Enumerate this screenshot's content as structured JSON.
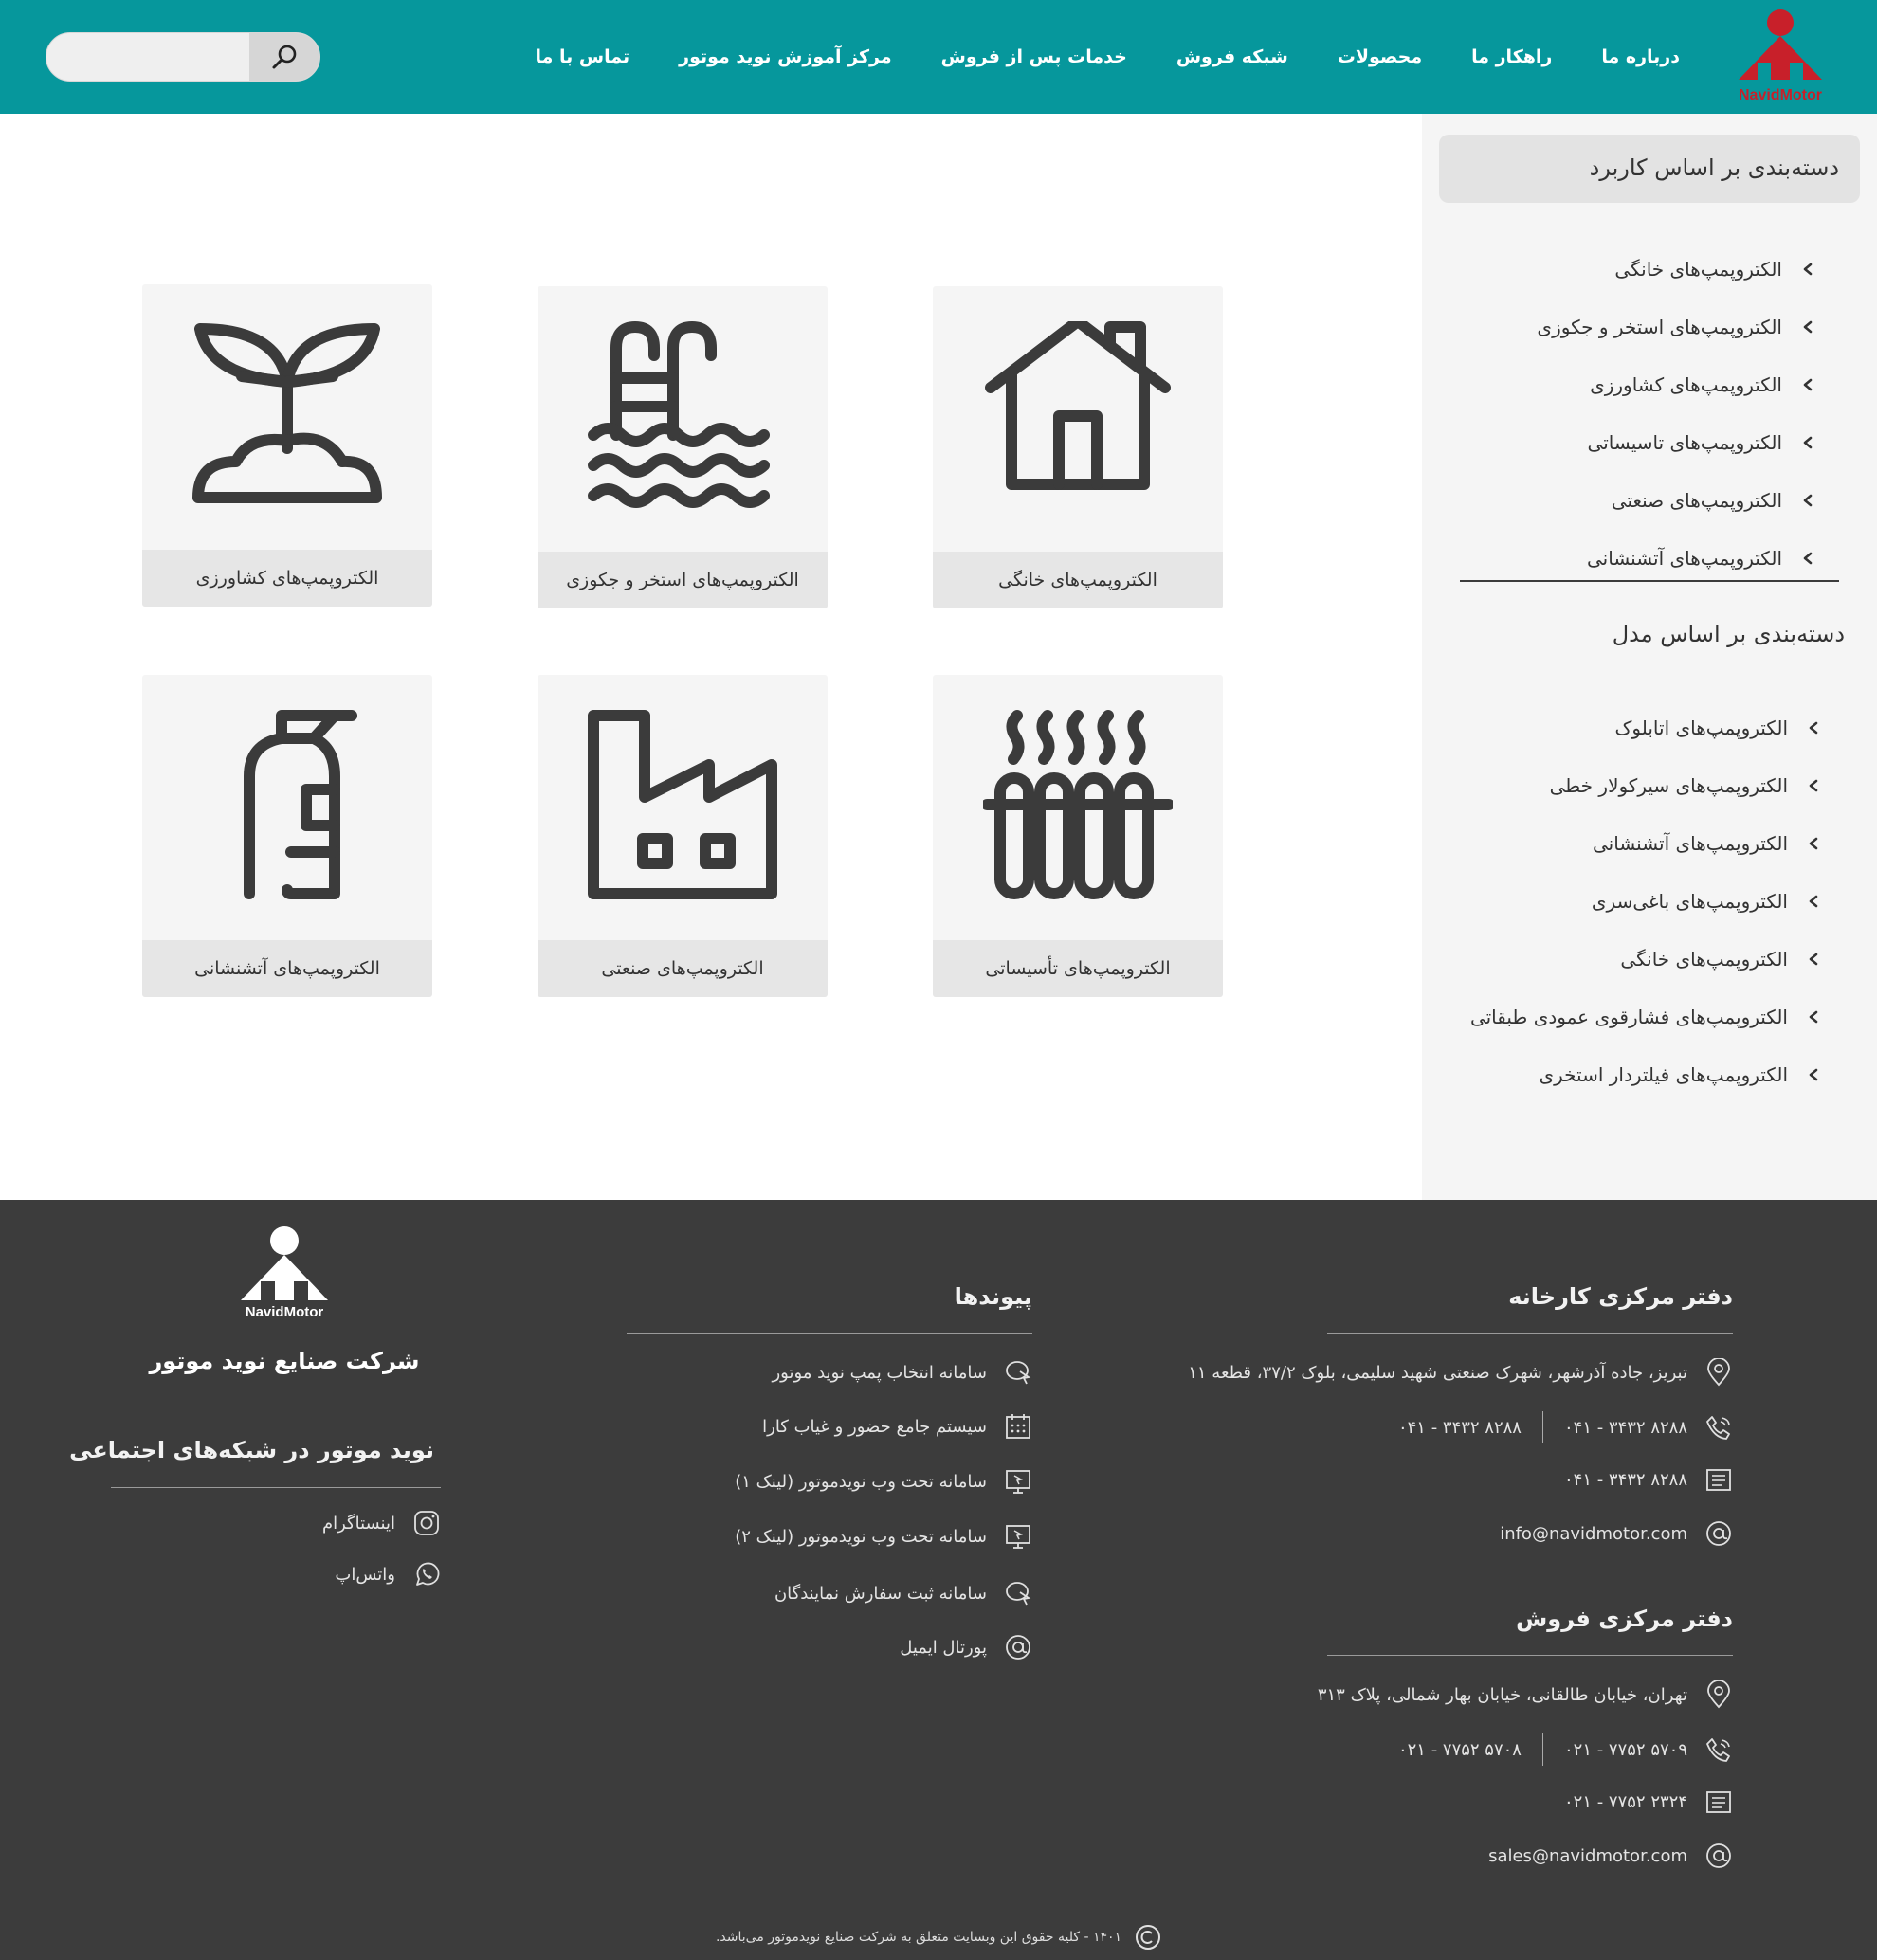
{
  "header": {
    "logo_text": "NavidMotor",
    "nav": [
      "درباره ما",
      "راهکار ما",
      "محصولات",
      "شبکه فروش",
      "خدمات پس از فروش",
      "مرکز آموزش نوید موتور",
      "تماس با ما"
    ],
    "search": {
      "placeholder": "",
      "icon": "search-icon"
    }
  },
  "sidebar": {
    "usage_title": "دسته‌بندی بر اساس کاربرد",
    "usage_items": [
      "الکتروپمپ‌های خانگی",
      "الکتروپمپ‌های استخر و جکوزی",
      "الکتروپمپ‌های کشاورزی",
      "الکتروپمپ‌های تاسیساتی",
      "الکتروپمپ‌های صنعتی",
      "الکتروپمپ‌های آتشنشانی"
    ],
    "model_title": "دسته‌بندی بر اساس مدل",
    "model_items": [
      "الکتروپمپ‌های اتابلوک",
      "الکتروپمپ‌های سیرکولار خطی",
      "الکتروپمپ‌های آتشنشانی",
      "الکتروپمپ‌های باغی‌سری",
      "الکتروپمپ‌های خانگی",
      "الکتروپمپ‌های فشارقوی عمودی طبقاتی",
      "الکتروپمپ‌های فیلتردار استخری"
    ]
  },
  "categories": [
    {
      "label": "الکتروپمپ‌های خانگی",
      "icon": "house-icon"
    },
    {
      "label": "الکتروپمپ‌های استخر و جکوزی",
      "icon": "pool-icon"
    },
    {
      "label": "الکتروپمپ‌های کشاورزی",
      "icon": "plant-icon"
    },
    {
      "label": "الکتروپمپ‌های تأسیساتی",
      "icon": "radiator-icon"
    },
    {
      "label": "الکتروپمپ‌های صنعتی",
      "icon": "factory-icon"
    },
    {
      "label": "الکتروپمپ‌های آتشنشانی",
      "icon": "fire-extinguisher-icon"
    }
  ],
  "footer": {
    "factory": {
      "title": "دفتر مرکزی کارخانه",
      "address": "تبریز، جاده آذرشهر، شهرک صنعتی شهید سلیمی، بلوک ۳۷/۲، قطعه ۱۱",
      "phone1": "۰۴۱ - ۳۴۳۲ ۸۲۸۸",
      "phone2": "۰۴۱ - ۳۴۳۲ ۸۲۸۸",
      "fax": "۰۴۱ - ۳۴۳۲ ۸۲۸۸",
      "email": "info@navidmotor.com"
    },
    "sales": {
      "title": "دفتر مرکزی فروش",
      "address": "تهران، خیابان طالقانی، خیابان بهار شمالی، پلاک ۳۱۳",
      "phone1": "۰۲۱ - ۷۷۵۲ ۵۷۰۹",
      "phone2": "۰۲۱ - ۷۷۵۲ ۵۷۰۸",
      "fax": "۰۲۱ - ۷۷۵۲ ۲۳۲۴",
      "email": "sales@navidmotor.com"
    },
    "links": {
      "title": "پیوندها",
      "items": [
        "سامانه انتخاب پمپ نوید موتور",
        "سیستم جامع حضور و غیاب کارا",
        "سامانه تحت وب نویدموتور (لینک ۱)",
        "سامانه تحت وب نویدموتور (لینک ۲)",
        "سامانه ثبت سفارش نمایندگان",
        "پورتال ایمیل"
      ]
    },
    "brand": {
      "logo_text": "NavidMotor",
      "company": "شرکت صنایع نوید موتور",
      "social_title": "نوید موتور در شبکه‌های اجتماعی",
      "instagram": "اینستاگرام",
      "whatsapp": "واتس‌اپ"
    },
    "copyright": "۱۴۰۱ - کلیه حقوق این وبسایت متعلق به شرکت صنایع نویدموتور می‌باشد."
  },
  "colors": {
    "header": "#06979c",
    "logo_red": "#c8202a",
    "footer": "#3c3c3c",
    "sidebar": "#f5f5f5"
  }
}
